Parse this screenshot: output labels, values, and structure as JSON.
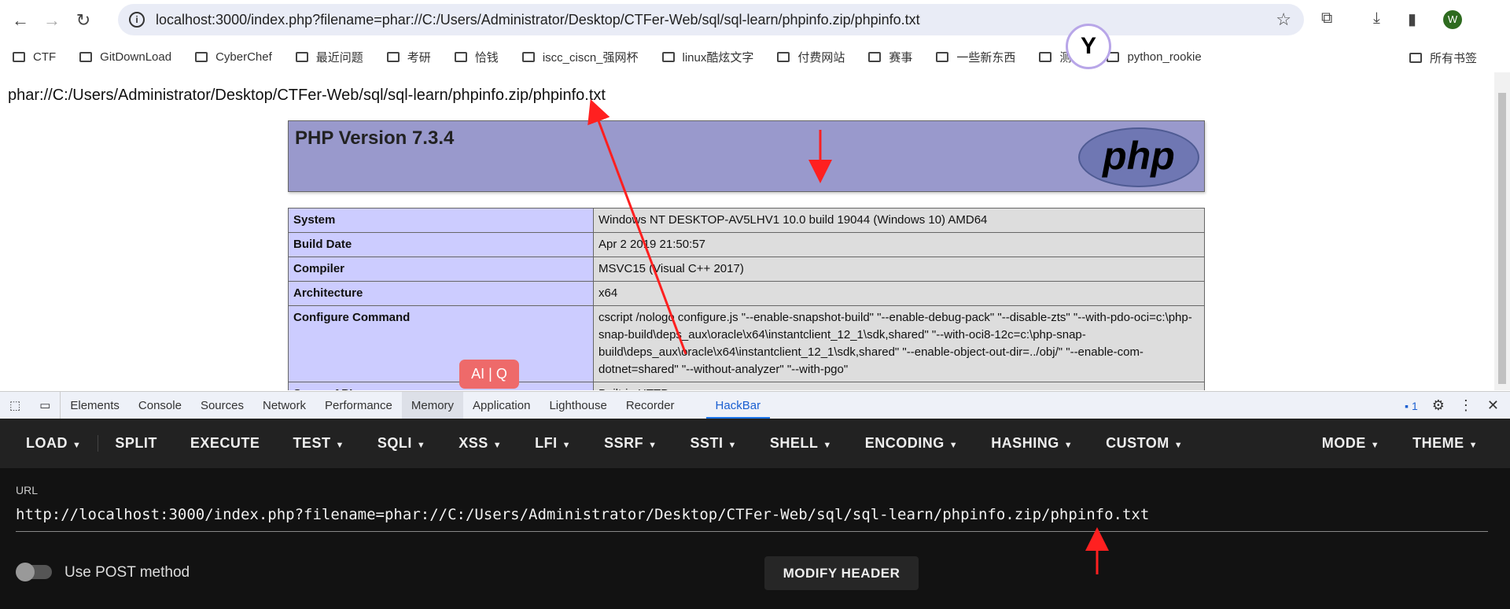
{
  "browser": {
    "address": "localhost:3000/index.php?filename=phar://C:/Users/Administrator/Desktop/CTFer-Web/sql/sql-learn/phpinfo.zip/phpinfo.txt",
    "avatar_letter": "W",
    "bookmarks": [
      "CTF",
      "GitDownLoad",
      "CyberChef",
      "最近问题",
      "考研",
      "恰钱",
      "iscc_ciscn_强网杯",
      "linux酷炫文字",
      "付费网站",
      "赛事",
      "一些新东西",
      "测试",
      "python_rookie"
    ],
    "all_bookmarks": "所有书签"
  },
  "page": {
    "heading": "phar://C:/Users/Administrator/Desktop/CTFer-Web/sql/sql-learn/phpinfo.zip/phpinfo.txt",
    "php_version": "PHP Version 7.3.4",
    "logo_text": "php",
    "rows": [
      {
        "k": "System",
        "v": "Windows NT DESKTOP-AV5LHV1 10.0 build 19044 (Windows 10) AMD64"
      },
      {
        "k": "Build Date",
        "v": "Apr 2 2019 21:50:57"
      },
      {
        "k": "Compiler",
        "v": "MSVC15 (Visual C++ 2017)"
      },
      {
        "k": "Architecture",
        "v": "x64"
      },
      {
        "k": "Configure Command",
        "v": "cscript /nologo configure.js \"--enable-snapshot-build\" \"--enable-debug-pack\" \"--disable-zts\" \"--with-pdo-oci=c:\\php-snap-build\\deps_aux\\oracle\\x64\\instantclient_12_1\\sdk,shared\" \"--with-oci8-12c=c:\\php-snap-build\\deps_aux\\oracle\\x64\\instantclient_12_1\\sdk,shared\" \"--enable-object-out-dir=../obj/\" \"--enable-com-dotnet=shared\" \"--without-analyzer\" \"--with-pgo\""
      },
      {
        "k": "Server API",
        "v": "Built-in HTTP server"
      }
    ],
    "ai_badge": "AI | Q"
  },
  "devtools": {
    "tabs": [
      "Elements",
      "Console",
      "Sources",
      "Network",
      "Performance",
      "Memory",
      "Application",
      "Lighthouse",
      "Recorder",
      "HackBar"
    ],
    "selected": "Memory",
    "active": "HackBar",
    "issues_count": "1"
  },
  "hackbar": {
    "menu": [
      "LOAD",
      "SPLIT",
      "EXECUTE",
      "TEST",
      "SQLI",
      "XSS",
      "LFI",
      "SSRF",
      "SSTI",
      "SHELL",
      "ENCODING",
      "HASHING",
      "CUSTOM"
    ],
    "right_menu": [
      "MODE",
      "THEME"
    ],
    "url_label": "URL",
    "url_value": "http://localhost:3000/index.php?filename=phar://C:/Users/Administrator/Desktop/CTFer-Web/sql/sql-learn/phpinfo.zip/phpinfo.txt",
    "post_label": "Use POST method",
    "post_enabled": false,
    "modify_header": "MODIFY HEADER"
  },
  "colors": {
    "php_header": "#9999cc",
    "php_key": "#ccccff",
    "php_value": "#dddddd",
    "annotation": "#ff2020",
    "hackbar_bg": "#121212"
  }
}
